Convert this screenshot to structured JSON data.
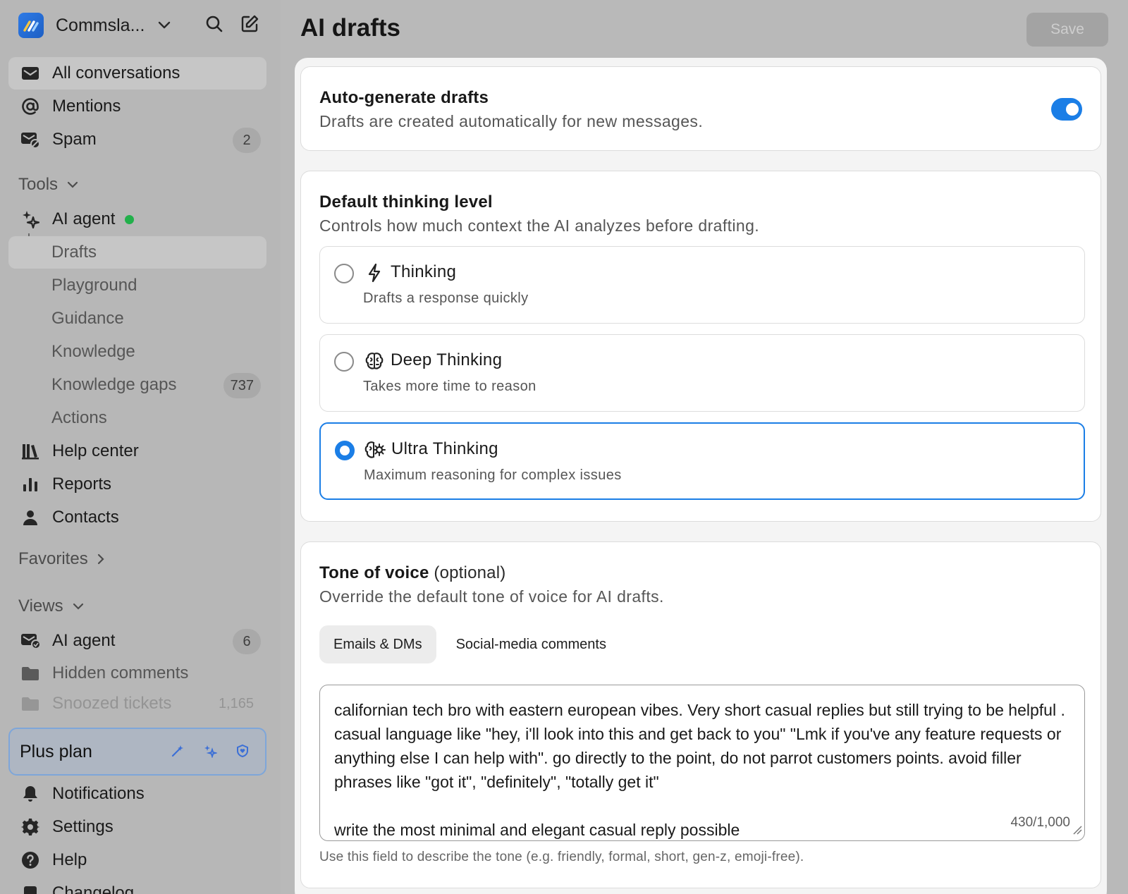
{
  "workspace": {
    "name": "Commsla..."
  },
  "sidebar": {
    "primary": [
      {
        "label": "All conversations",
        "icon": "inbox-icon"
      },
      {
        "label": "Mentions",
        "icon": "at-icon"
      },
      {
        "label": "Spam",
        "icon": "spam-icon",
        "badge": "2"
      }
    ],
    "tools_label": "Tools",
    "tools": [
      {
        "label": "AI agent",
        "icon": "sparkle-icon",
        "status": "online"
      },
      {
        "label": "Drafts"
      },
      {
        "label": "Playground"
      },
      {
        "label": "Guidance"
      },
      {
        "label": "Knowledge"
      },
      {
        "label": "Knowledge gaps",
        "badge": "737"
      },
      {
        "label": "Actions"
      },
      {
        "label": "Help center",
        "icon": "library-icon"
      },
      {
        "label": "Reports",
        "icon": "bar-chart-icon"
      },
      {
        "label": "Contacts",
        "icon": "person-icon"
      }
    ],
    "favorites_label": "Favorites",
    "views_label": "Views",
    "views": [
      {
        "label": "AI agent",
        "icon": "inbox-user-icon",
        "badge": "6"
      },
      {
        "label": "Hidden comments",
        "icon": "folder-icon"
      },
      {
        "label": "Snoozed tickets",
        "icon": "folder-icon",
        "badge": "1,165"
      }
    ],
    "plan": {
      "label": "Plus plan"
    },
    "bottom": [
      {
        "label": "Notifications",
        "icon": "bell-icon"
      },
      {
        "label": "Settings",
        "icon": "gear-icon"
      },
      {
        "label": "Help",
        "icon": "help-icon"
      },
      {
        "label": "Changelog",
        "icon": "changelog-icon"
      }
    ]
  },
  "main": {
    "title": "AI drafts",
    "save_label": "Save",
    "auto_generate": {
      "title": "Auto-generate drafts",
      "description": "Drafts are created automatically for new messages.",
      "enabled": true
    },
    "thinking": {
      "title": "Default thinking level",
      "description": "Controls how much context the AI analyzes before drafting.",
      "options": [
        {
          "title": "Thinking",
          "subtitle": "Drafts a response quickly",
          "icon": "bolt-icon",
          "selected": false
        },
        {
          "title": "Deep Thinking",
          "subtitle": "Takes more time to reason",
          "icon": "brain-icon",
          "selected": false
        },
        {
          "title": "Ultra Thinking",
          "subtitle": "Maximum reasoning for complex issues",
          "icon": "brain-gear-icon",
          "selected": true
        }
      ]
    },
    "tone": {
      "title": "Tone of voice",
      "optional": "(optional)",
      "description": "Override the default tone of voice for AI drafts.",
      "tabs": [
        {
          "label": "Emails & DMs",
          "active": true
        },
        {
          "label": "Social-media comments",
          "active": false
        }
      ],
      "value": "californian tech bro with eastern european vibes. Very short casual replies but still trying to be helpful . casual language like \"hey, i'll look into this and get back to you\" \"Lmk if you've any feature requests or anything else I can help with\". go directly to the point, do not parrot customers points. avoid filler phrases like \"got it\", \"definitely\", \"totally get it\"\n\nwrite the most minimal and elegant casual reply possible",
      "counter": "430/1,000",
      "helper": "Use this field to describe the tone (e.g. friendly, formal, short, gen-z, emoji-free)."
    }
  },
  "colors": {
    "accent": "#1b7ee6",
    "online": "#22b04b"
  }
}
